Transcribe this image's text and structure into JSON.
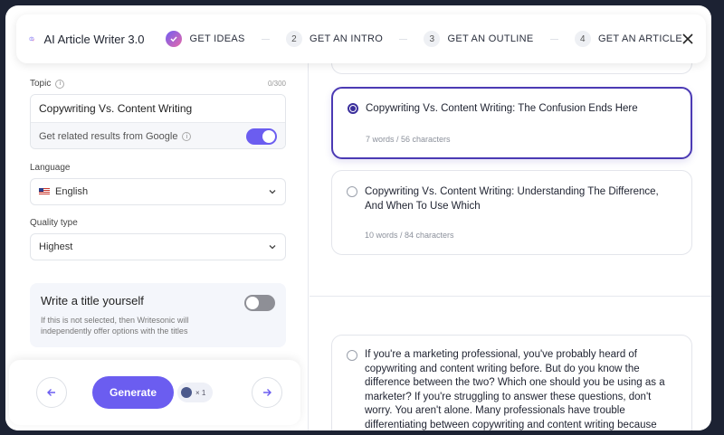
{
  "header": {
    "app_title": "AI Article Writer 3.0",
    "steps": [
      {
        "num": "",
        "label": "GET IDEAS",
        "done": true
      },
      {
        "num": "2",
        "label": "GET AN INTRO"
      },
      {
        "num": "3",
        "label": "GET AN OUTLINE"
      },
      {
        "num": "4",
        "label": "GET AN ARTICLE"
      }
    ]
  },
  "form": {
    "topic_label": "Topic",
    "topic_counter": "0/300",
    "topic_value": "Copywriting Vs. Content Writing",
    "google_label": "Get related results from Google",
    "google_enabled": true,
    "language_label": "Language",
    "language_value": "English",
    "quality_label": "Quality type",
    "quality_value": "Highest",
    "write_title_label": "Write a title yourself",
    "write_title_desc": "If this is not selected, then Writesonic will independently offer options with the titles",
    "write_title_enabled": false
  },
  "footer": {
    "generate_label": "Generate",
    "credit_label": "× 1"
  },
  "results": {
    "titles": [
      {
        "text": "Copywriting Vs. Content Writing: The Confusion Ends Here",
        "meta": "7 words / 56 characters",
        "selected": true
      },
      {
        "text": "Copywriting Vs. Content Writing: Understanding The Difference, And When To Use Which",
        "meta": "10 words / 84 characters",
        "selected": false
      }
    ],
    "intro_text": "If you're a marketing professional, you've probably heard of copywriting and content writing before. But do you know the difference between the two? Which one should you be using as a marketer? If you're struggling to answer these questions, don't worry. You aren't alone. Many professionals have trouble differentiating between copywriting and content writing because"
  },
  "colors": {
    "accent": "#6b5df0",
    "selected_border": "#4b3ab4",
    "frame_bg": "#1c2233"
  }
}
